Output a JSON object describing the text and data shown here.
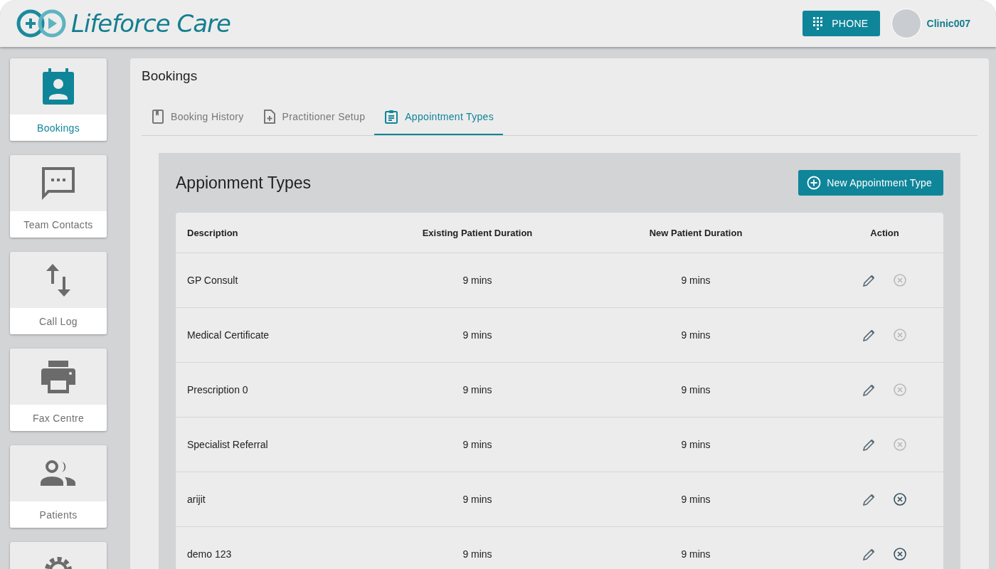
{
  "header": {
    "logo_text": "Lifeforce Care",
    "phone_button": "PHONE",
    "user_name": "Clinic007"
  },
  "sidebar": {
    "items": [
      {
        "kind": "bookings",
        "label": "Bookings",
        "selected": true
      },
      {
        "kind": "contacts",
        "label": "Team Contacts",
        "selected": false
      },
      {
        "kind": "calllog",
        "label": "Call Log",
        "selected": false
      },
      {
        "kind": "fax",
        "label": "Fax Centre",
        "selected": false
      },
      {
        "kind": "patients",
        "label": "Patients",
        "selected": false
      },
      {
        "kind": "settings",
        "selected": false
      }
    ]
  },
  "page_title": "Bookings",
  "tabs": [
    {
      "kind": "history",
      "label": "Booking History",
      "selected": false
    },
    {
      "kind": "setup",
      "label": "Practitioner Setup",
      "selected": false
    },
    {
      "kind": "types",
      "label": "Appointment Types",
      "selected": true
    }
  ],
  "section": {
    "title": "Appionment Types",
    "new_button": "New Appointment Type"
  },
  "table": {
    "columns": [
      "Description",
      "Existing Patient Duration",
      "New Patient Duration",
      "Action"
    ],
    "rows": [
      {
        "description": "GP Consult",
        "existing": "9 mins",
        "new": "9 mins",
        "delete_enabled": false
      },
      {
        "description": "Medical Certificate",
        "existing": "9 mins",
        "new": "9 mins",
        "delete_enabled": false
      },
      {
        "description": "Prescription 0",
        "existing": "9 mins",
        "new": "9 mins",
        "delete_enabled": false
      },
      {
        "description": "Specialist Referral",
        "existing": "9 mins",
        "new": "9 mins",
        "delete_enabled": false
      },
      {
        "description": "arijit",
        "existing": "9 mins",
        "new": "9 mins",
        "delete_enabled": true
      },
      {
        "description": "demo 123",
        "existing": "9 mins",
        "new": "9 mins",
        "delete_enabled": true
      }
    ]
  }
}
